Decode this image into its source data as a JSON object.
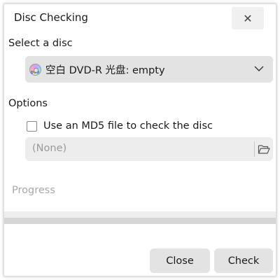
{
  "window": {
    "title": "Disc Checking",
    "close_glyph": "✕"
  },
  "select_disc": {
    "label": "Select a disc",
    "selected": "空白 DVD-R 光盘: empty",
    "icon": "dvd-disc-icon",
    "icon_text": "DVD"
  },
  "options": {
    "label": "Options",
    "md5_checkbox": {
      "label": "Use an MD5 file to check the disc",
      "checked": false
    },
    "file_field": {
      "value": "(None)",
      "icon": "folder-open-icon"
    }
  },
  "progress": {
    "label": "Progress",
    "fraction": 0
  },
  "buttons": {
    "close": "Close",
    "check": "Check"
  }
}
